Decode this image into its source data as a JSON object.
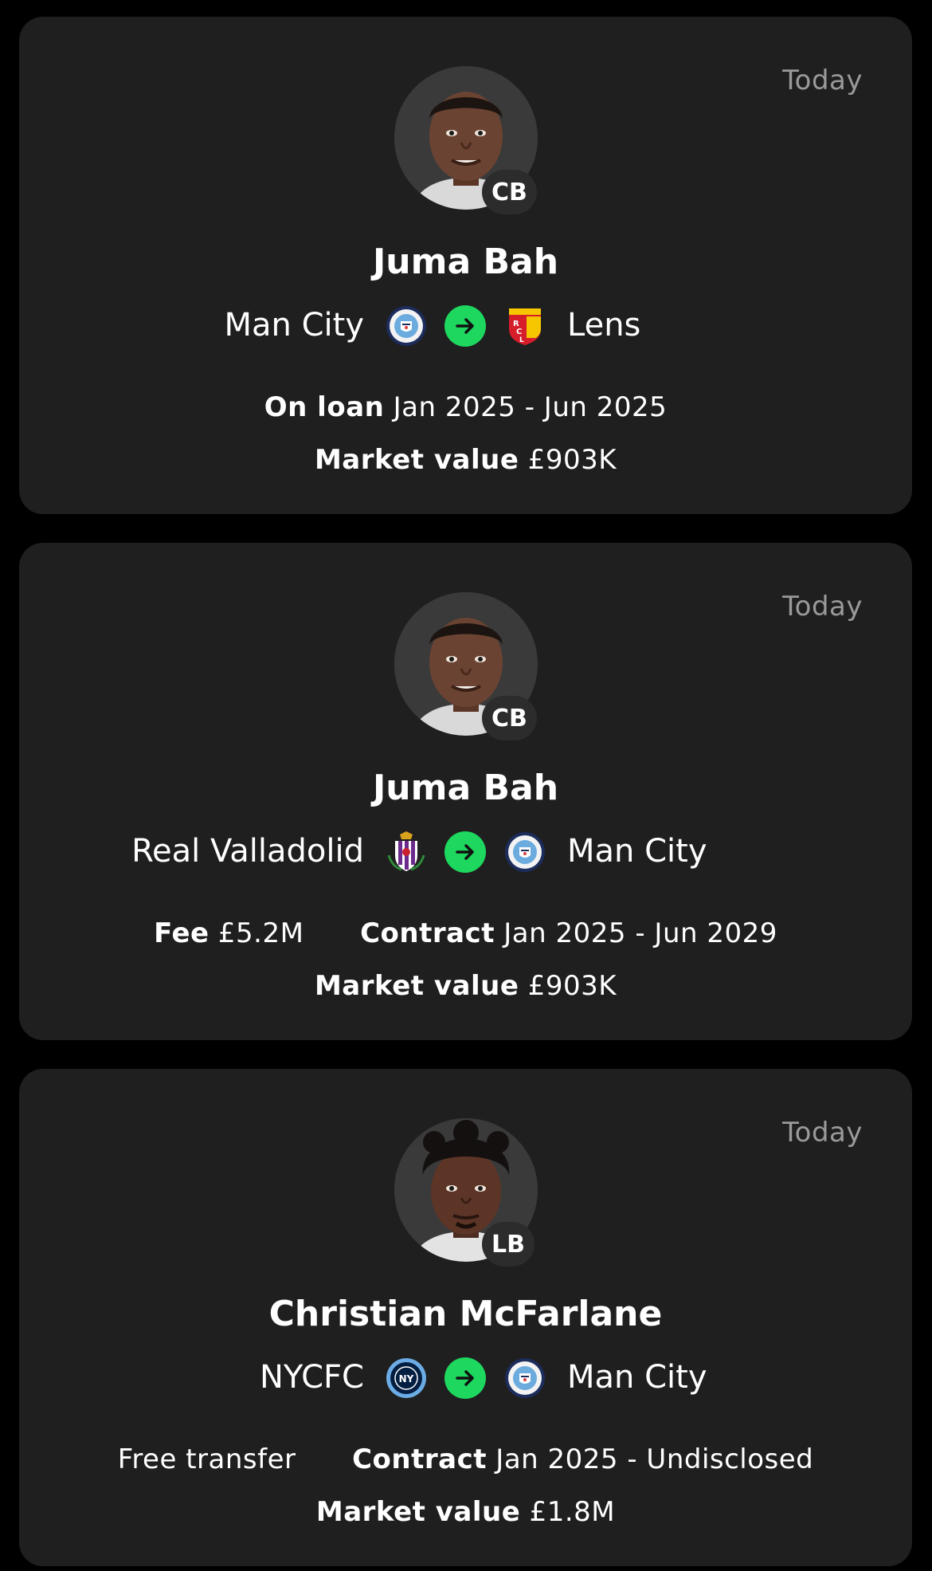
{
  "colors": {
    "background": "#000000",
    "card": "#1f1f1f",
    "accent_green": "#1ed75f",
    "muted_text": "#9a9a9a"
  },
  "transfers": [
    {
      "date": "Today",
      "position": "CB",
      "player": "Juma Bah",
      "from_club": "Man City",
      "from_crest": "man-city-crest",
      "to_club": "Lens",
      "to_crest": "lens-crest",
      "detail1_label": "On loan",
      "detail1_value": "Jan 2025 - Jun 2025",
      "market_label": "Market value",
      "market_value": "£903K"
    },
    {
      "date": "Today",
      "position": "CB",
      "player": "Juma Bah",
      "from_club": "Real Valladolid",
      "from_crest": "real-valladolid-crest",
      "to_club": "Man City",
      "to_crest": "man-city-crest",
      "fee_label": "Fee",
      "fee_value": "£5.2M",
      "contract_label": "Contract",
      "contract_value": "Jan 2025 - Jun 2029",
      "market_label": "Market value",
      "market_value": "£903K"
    },
    {
      "date": "Today",
      "position": "LB",
      "player": "Christian McFarlane",
      "from_club": "NYCFC",
      "from_crest": "nycfc-crest",
      "to_club": "Man City",
      "to_crest": "man-city-crest",
      "fee_text": "Free transfer",
      "contract_label": "Contract",
      "contract_value": "Jan 2025 - Undisclosed",
      "market_label": "Market value",
      "market_value": "£1.8M"
    }
  ]
}
